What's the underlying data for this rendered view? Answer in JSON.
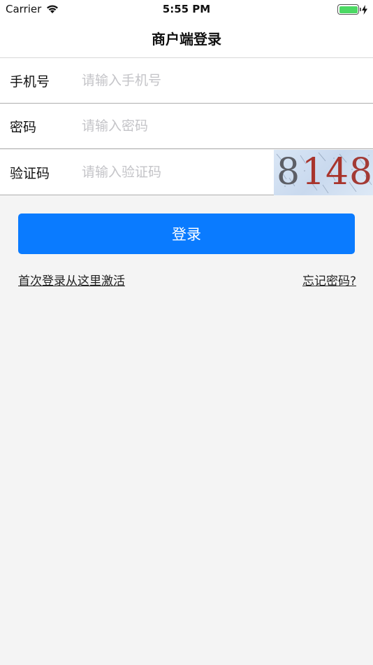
{
  "status_bar": {
    "carrier": "Carrier",
    "time": "5:55 PM"
  },
  "nav": {
    "title": "商户端登录"
  },
  "form": {
    "phone": {
      "label": "手机号",
      "placeholder": "请输入手机号",
      "value": ""
    },
    "password": {
      "label": "密码",
      "placeholder": "请输入密码",
      "value": ""
    },
    "captcha": {
      "label": "验证码",
      "placeholder": "请输入验证码",
      "value": "",
      "digits": [
        "8",
        "1",
        "4",
        "8"
      ],
      "digit_colors": [
        "#5d5f66",
        "#a8342c",
        "#a8342c",
        "#a33a35"
      ]
    }
  },
  "login_button": {
    "label": "登录"
  },
  "links": {
    "activate": "首次登录从这里激活",
    "forgot": "忘记密码?"
  },
  "colors": {
    "accent": "#0a7bff",
    "battery": "#4cd964",
    "background": "#f4f4f4"
  }
}
